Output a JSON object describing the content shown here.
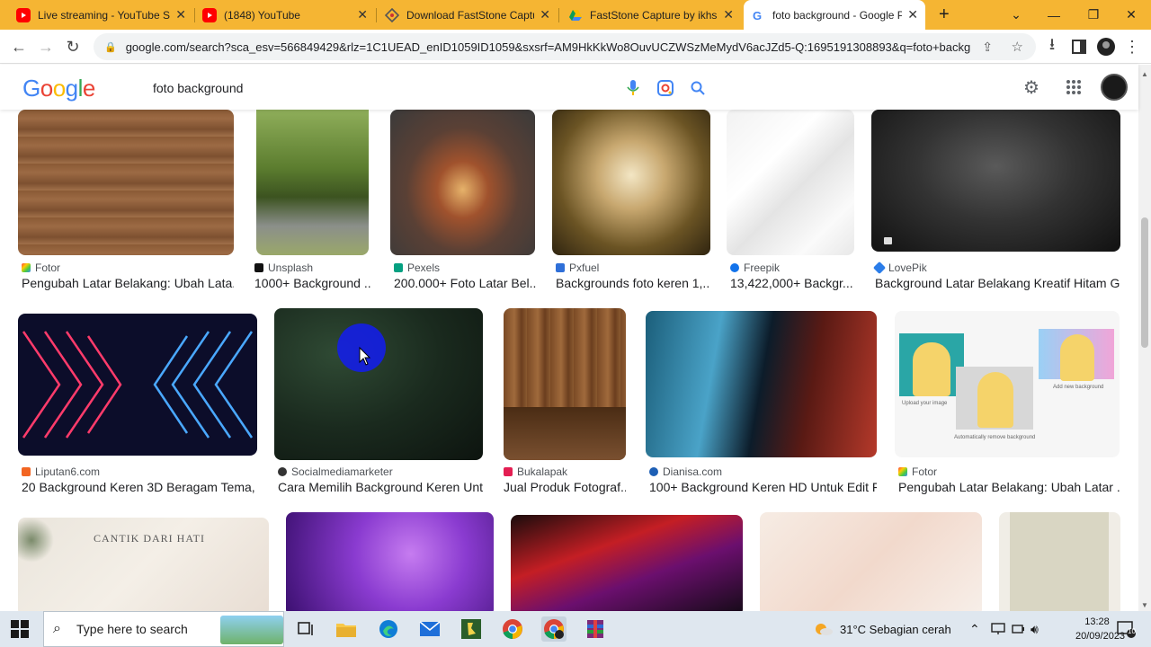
{
  "browser": {
    "tabs": [
      {
        "title": "Live streaming - YouTube Stu",
        "icon": "youtube-icon"
      },
      {
        "title": "(1848) YouTube",
        "icon": "youtube-icon"
      },
      {
        "title": "Download FastStone Capture",
        "icon": "site-icon"
      },
      {
        "title": "FastStone Capture by ikhsan",
        "icon": "drive-icon"
      },
      {
        "title": "foto background - Google Pe",
        "icon": "google-icon"
      }
    ],
    "new_tab": "+",
    "url": "google.com/search?sca_esv=566849429&rlz=1C1UEAD_enID1059ID1059&sxsrf=AM9HkKkWo8OuvUCZWSzMeMydV6acJZd5-Q:1695191308893&q=foto+backgro..."
  },
  "google": {
    "logo": "Google",
    "query": "foto background"
  },
  "results": [
    {
      "source": "Fotor",
      "caption": "Pengubah Latar Belakang: Ubah Lata...",
      "color": "#e6a73f"
    },
    {
      "source": "Unsplash",
      "caption": "1000+ Background ...",
      "color": "#222222"
    },
    {
      "source": "Pexels",
      "caption": "200.000+ Foto Latar Bel...",
      "color": "#05a081"
    },
    {
      "source": "Pxfuel",
      "caption": "Backgrounds foto keren 1,...",
      "color": "#2f6fd8"
    },
    {
      "source": "Freepik",
      "caption": "13,422,000+ Backgr...",
      "color": "#1273eb"
    },
    {
      "source": "LovePik",
      "caption": "Background Latar Belakang Kreatif Hitam G...",
      "color": "#2b7de9"
    },
    {
      "source": "Liputan6.com",
      "caption": "20 Background Keren 3D Beragam Tema, ...",
      "color": "#f26522"
    },
    {
      "source": "Socialmediamarketer",
      "caption": "Cara Memilih Background Keren Unt...",
      "color": "#333333"
    },
    {
      "source": "Bukalapak",
      "caption": "Jual Produk Fotograf...",
      "color": "#e31e52"
    },
    {
      "source": "Dianisa.com",
      "caption": "100+ Background Keren HD Untuk Edit F...",
      "color": "#1d5fb5"
    },
    {
      "source": "Fotor",
      "caption": "Pengubah Latar Belakang: Ubah Latar ...",
      "color": "#e6a73f"
    }
  ],
  "image_texts": {
    "upload": "Upload your image",
    "add": "Add new background",
    "auto": "Automatically remove background",
    "cantik": "CANTIK DARI HATI"
  },
  "taskbar": {
    "search_placeholder": "Type here to search",
    "weather": "31°C  Sebagian cerah",
    "time": "13:28",
    "date": "20/09/2023",
    "notifications": "10"
  }
}
